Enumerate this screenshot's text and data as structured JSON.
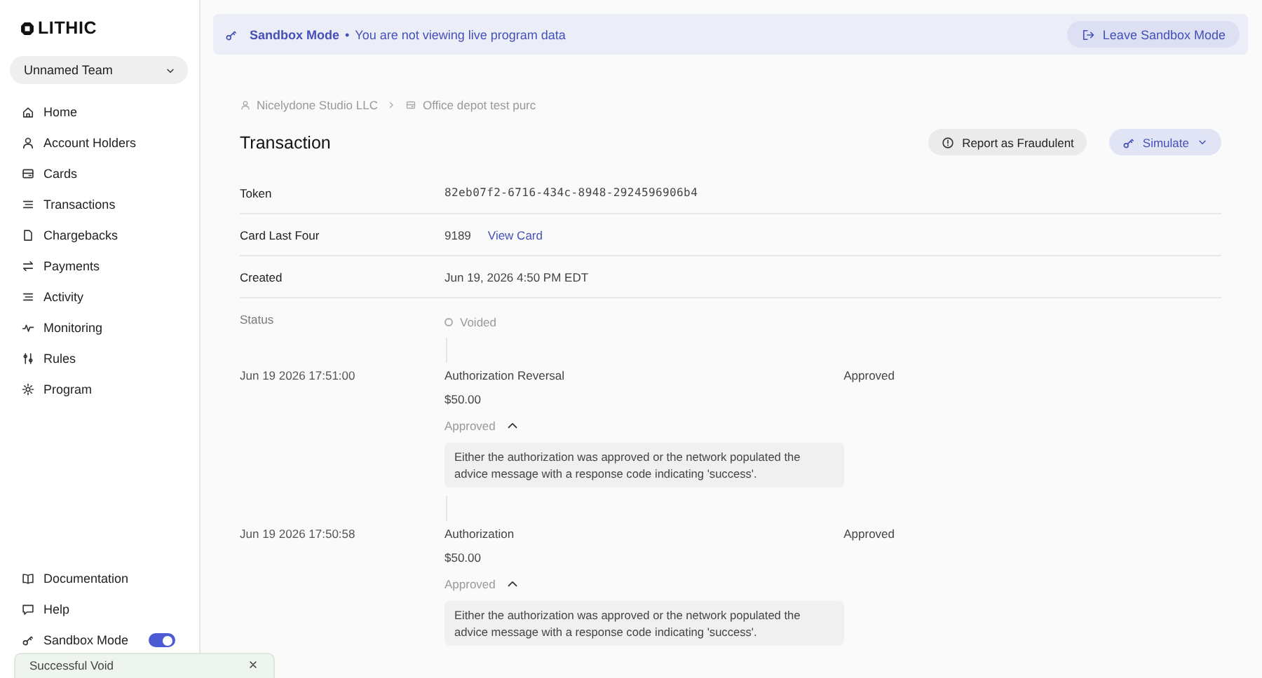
{
  "logo": {
    "text": "LITHIC"
  },
  "team_selector": {
    "label": "Unnamed Team"
  },
  "nav_items": [
    {
      "label": "Home"
    },
    {
      "label": "Account Holders"
    },
    {
      "label": "Cards"
    },
    {
      "label": "Transactions"
    },
    {
      "label": "Chargebacks"
    },
    {
      "label": "Payments"
    },
    {
      "label": "Activity"
    },
    {
      "label": "Monitoring"
    },
    {
      "label": "Rules"
    },
    {
      "label": "Program"
    }
  ],
  "footer_items": [
    {
      "label": "Documentation",
      "kind": "link"
    },
    {
      "label": "Help",
      "kind": "link"
    },
    {
      "label": "Sandbox Mode",
      "kind": "toggle",
      "on": true
    }
  ],
  "toast": {
    "text": "Successful Void"
  },
  "banner": {
    "title": "Sandbox Mode",
    "separator": "•",
    "message": "You are not viewing live program data",
    "button": "Leave Sandbox Mode"
  },
  "breadcrumbs": [
    {
      "label": "Nicelydone Studio LLC"
    },
    {
      "label": "Office depot test purc"
    }
  ],
  "page_title": "Transaction",
  "actions": [
    {
      "label": "Report as Fraudulent",
      "kind": "report"
    },
    {
      "label": "Simulate",
      "kind": "simulate"
    }
  ],
  "details": [
    {
      "label": "Token",
      "value": "82eb07f2-6716-434c-8948-2924596906b4",
      "kind": "mono"
    },
    {
      "label": "Card Last Four",
      "value": "9189",
      "link": "View Card",
      "kind": "link"
    },
    {
      "label": "Created",
      "value": "Jun 19, 2026 4:50 PM EDT",
      "kind": "text"
    }
  ],
  "status": {
    "label": "Status",
    "value": "Voided"
  },
  "events": [
    {
      "time": "Jun 19 2026 17:51:00",
      "type": "Authorization Reversal",
      "result": "Approved",
      "amount": "$50.00",
      "detail_label": "Approved",
      "expanded": true,
      "description": "Either the authorization was approved or the network populated the advice message with a response code indicating 'success'."
    },
    {
      "time": "Jun 19 2026 17:50:58",
      "type": "Authorization",
      "result": "Approved",
      "amount": "$50.00",
      "detail_label": "Approved",
      "expanded": true,
      "description": "Either the authorization was approved or the network populated the advice message with a response code indicating 'success'."
    }
  ]
}
